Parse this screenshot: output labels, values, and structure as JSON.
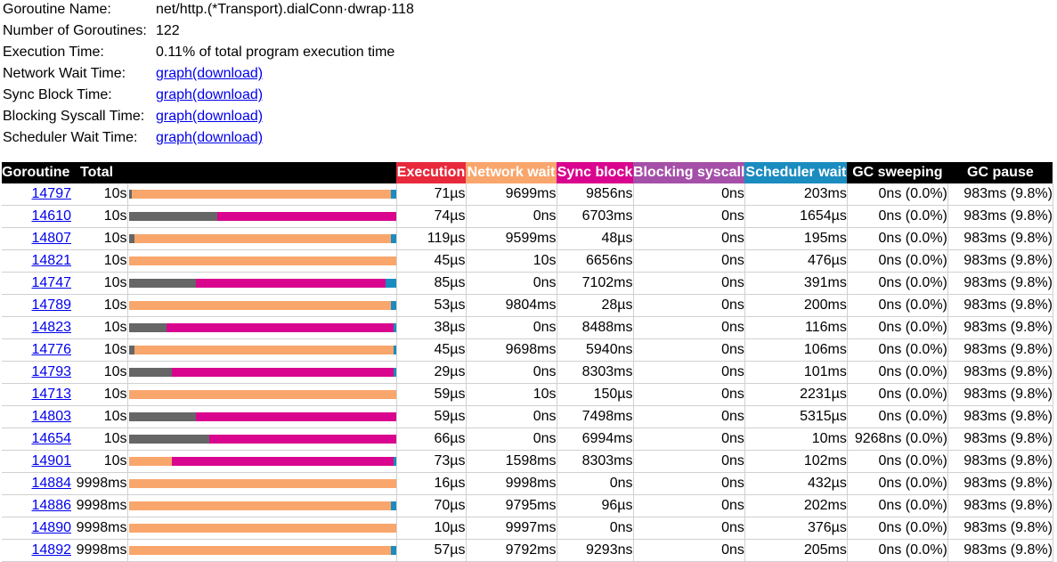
{
  "summary": {
    "name_label": "Goroutine Name:",
    "name_value": "net/http.(*Transport).dialConn·dwrap·118",
    "count_label": "Number of Goroutines:",
    "count_value": "122",
    "exec_label": "Execution Time:",
    "exec_value": "0.11% of total program execution time",
    "links": [
      {
        "label": "Network Wait Time:",
        "graph": "graph",
        "download": "(download)"
      },
      {
        "label": "Sync Block Time:",
        "graph": "graph",
        "download": "(download)"
      },
      {
        "label": "Blocking Syscall Time:",
        "graph": "graph",
        "download": "(download)"
      },
      {
        "label": "Scheduler Wait Time:",
        "graph": "graph",
        "download": "(download)"
      }
    ]
  },
  "colors": {
    "execution": "#e8293c",
    "network": "#f9a66c",
    "sync": "#d9058e",
    "syscall": "#a550a8",
    "scheduler": "#1b8cc0",
    "other": "#666666"
  },
  "table": {
    "headers": {
      "goroutine": "Goroutine",
      "total": "Total",
      "execution": "Execution",
      "network": "Network wait",
      "sync": "Sync block",
      "syscall": "Blocking syscall",
      "scheduler": "Scheduler wait",
      "gc_sweep": "GC sweeping",
      "gc_pause": "GC pause"
    },
    "rows": [
      {
        "id": "14797",
        "total": "10s",
        "exec": "71µs",
        "net": "9699ms",
        "sync": "9856ns",
        "sys": "0ns",
        "sched": "203ms",
        "sweep": "0ns (0.0%)",
        "pause": "983ms (9.8%)",
        "bar": {
          "other": 0.01,
          "network": 0.97,
          "sync": 0,
          "scheduler": 0.02
        }
      },
      {
        "id": "14610",
        "total": "10s",
        "exec": "74µs",
        "net": "0ns",
        "sync": "6703ms",
        "sys": "0ns",
        "sched": "1654µs",
        "sweep": "0ns (0.0%)",
        "pause": "983ms (9.8%)",
        "bar": {
          "other": 0.33,
          "network": 0,
          "sync": 0.67,
          "scheduler": 0
        }
      },
      {
        "id": "14807",
        "total": "10s",
        "exec": "119µs",
        "net": "9599ms",
        "sync": "48µs",
        "sys": "0ns",
        "sched": "195ms",
        "sweep": "0ns (0.0%)",
        "pause": "983ms (9.8%)",
        "bar": {
          "other": 0.02,
          "network": 0.96,
          "sync": 0,
          "scheduler": 0.02
        }
      },
      {
        "id": "14821",
        "total": "10s",
        "exec": "45µs",
        "net": "10s",
        "sync": "6656ns",
        "sys": "0ns",
        "sched": "476µs",
        "sweep": "0ns (0.0%)",
        "pause": "983ms (9.8%)",
        "bar": {
          "other": 0,
          "network": 1.0,
          "sync": 0,
          "scheduler": 0
        }
      },
      {
        "id": "14747",
        "total": "10s",
        "exec": "85µs",
        "net": "0ns",
        "sync": "7102ms",
        "sys": "0ns",
        "sched": "391ms",
        "sweep": "0ns (0.0%)",
        "pause": "983ms (9.8%)",
        "bar": {
          "other": 0.25,
          "network": 0,
          "sync": 0.71,
          "scheduler": 0.04
        }
      },
      {
        "id": "14789",
        "total": "10s",
        "exec": "53µs",
        "net": "9804ms",
        "sync": "28µs",
        "sys": "0ns",
        "sched": "200ms",
        "sweep": "0ns (0.0%)",
        "pause": "983ms (9.8%)",
        "bar": {
          "other": 0,
          "network": 0.98,
          "sync": 0,
          "scheduler": 0.02
        }
      },
      {
        "id": "14823",
        "total": "10s",
        "exec": "38µs",
        "net": "0ns",
        "sync": "8488ms",
        "sys": "0ns",
        "sched": "116ms",
        "sweep": "0ns (0.0%)",
        "pause": "983ms (9.8%)",
        "bar": {
          "other": 0.14,
          "network": 0,
          "sync": 0.85,
          "scheduler": 0.01
        }
      },
      {
        "id": "14776",
        "total": "10s",
        "exec": "45µs",
        "net": "9698ms",
        "sync": "5940ns",
        "sys": "0ns",
        "sched": "106ms",
        "sweep": "0ns (0.0%)",
        "pause": "983ms (9.8%)",
        "bar": {
          "other": 0.02,
          "network": 0.97,
          "sync": 0,
          "scheduler": 0.01
        }
      },
      {
        "id": "14793",
        "total": "10s",
        "exec": "29µs",
        "net": "0ns",
        "sync": "8303ms",
        "sys": "0ns",
        "sched": "101ms",
        "sweep": "0ns (0.0%)",
        "pause": "983ms (9.8%)",
        "bar": {
          "other": 0.16,
          "network": 0,
          "sync": 0.83,
          "scheduler": 0.01
        }
      },
      {
        "id": "14713",
        "total": "10s",
        "exec": "59µs",
        "net": "10s",
        "sync": "150µs",
        "sys": "0ns",
        "sched": "2231µs",
        "sweep": "0ns (0.0%)",
        "pause": "983ms (9.8%)",
        "bar": {
          "other": 0,
          "network": 1.0,
          "sync": 0,
          "scheduler": 0
        }
      },
      {
        "id": "14803",
        "total": "10s",
        "exec": "59µs",
        "net": "0ns",
        "sync": "7498ms",
        "sys": "0ns",
        "sched": "5315µs",
        "sweep": "0ns (0.0%)",
        "pause": "983ms (9.8%)",
        "bar": {
          "other": 0.25,
          "network": 0,
          "sync": 0.75,
          "scheduler": 0
        }
      },
      {
        "id": "14654",
        "total": "10s",
        "exec": "66µs",
        "net": "0ns",
        "sync": "6994ms",
        "sys": "0ns",
        "sched": "10ms",
        "sweep": "9268ns (0.0%)",
        "pause": "983ms (9.8%)",
        "bar": {
          "other": 0.3,
          "network": 0,
          "sync": 0.7,
          "scheduler": 0
        }
      },
      {
        "id": "14901",
        "total": "10s",
        "exec": "73µs",
        "net": "1598ms",
        "sync": "8303ms",
        "sys": "0ns",
        "sched": "102ms",
        "sweep": "0ns (0.0%)",
        "pause": "983ms (9.8%)",
        "bar": {
          "other": 0,
          "network": 0.16,
          "sync": 0.83,
          "scheduler": 0.01
        }
      },
      {
        "id": "14884",
        "total": "9998ms",
        "exec": "16µs",
        "net": "9998ms",
        "sync": "0ns",
        "sys": "0ns",
        "sched": "432µs",
        "sweep": "0ns (0.0%)",
        "pause": "983ms (9.8%)",
        "bar": {
          "other": 0,
          "network": 1.0,
          "sync": 0,
          "scheduler": 0
        }
      },
      {
        "id": "14886",
        "total": "9998ms",
        "exec": "70µs",
        "net": "9795ms",
        "sync": "96µs",
        "sys": "0ns",
        "sched": "202ms",
        "sweep": "0ns (0.0%)",
        "pause": "983ms (9.8%)",
        "bar": {
          "other": 0,
          "network": 0.98,
          "sync": 0,
          "scheduler": 0.02
        }
      },
      {
        "id": "14890",
        "total": "9998ms",
        "exec": "10µs",
        "net": "9997ms",
        "sync": "0ns",
        "sys": "0ns",
        "sched": "376µs",
        "sweep": "0ns (0.0%)",
        "pause": "983ms (9.8%)",
        "bar": {
          "other": 0,
          "network": 1.0,
          "sync": 0,
          "scheduler": 0
        }
      },
      {
        "id": "14892",
        "total": "9998ms",
        "exec": "57µs",
        "net": "9792ms",
        "sync": "9293ns",
        "sys": "0ns",
        "sched": "205ms",
        "sweep": "0ns (0.0%)",
        "pause": "983ms (9.8%)",
        "bar": {
          "other": 0,
          "network": 0.98,
          "sync": 0,
          "scheduler": 0.02
        }
      }
    ]
  }
}
